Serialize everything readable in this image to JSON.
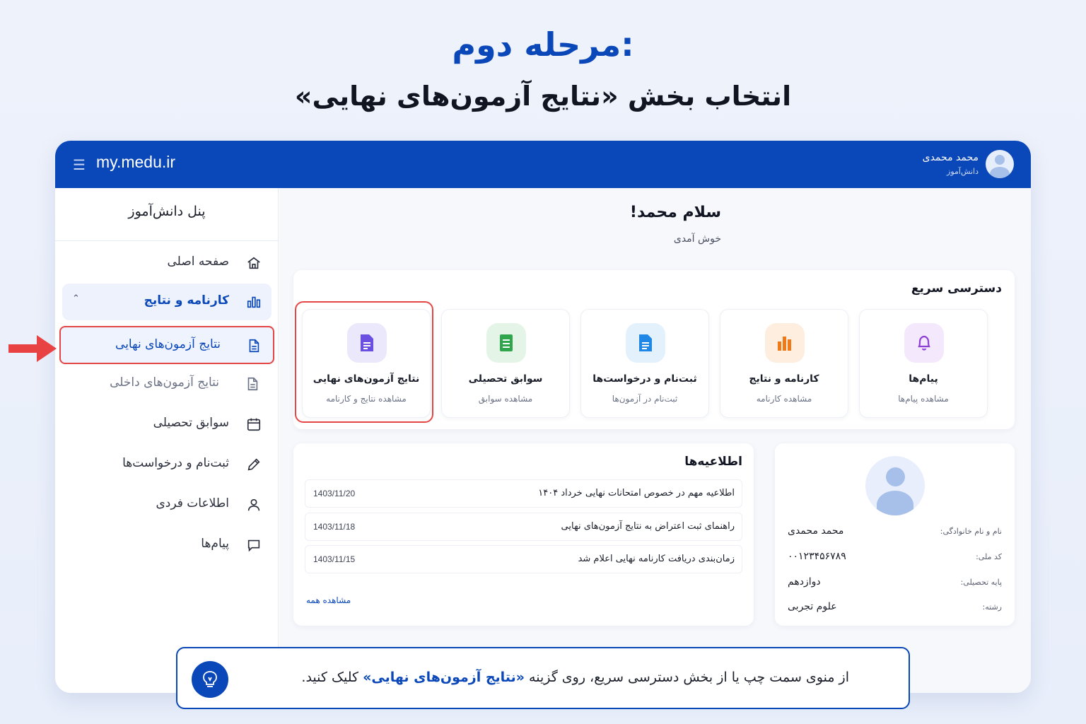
{
  "heading": {
    "step": "مرحله دوم:",
    "subtitle": "انتخاب بخش «نتایج آزمون‌های نهایی»"
  },
  "topbar": {
    "site": "my.medu.ir",
    "user_name": "محمد محمدی",
    "user_role": "دانش‌آموز",
    "menu_icon": "hamburger-icon",
    "bar_color": "#0a47b8"
  },
  "sidebar": {
    "title": "پنل دانش‌آموز",
    "items": [
      {
        "label": "صفحه اصلی",
        "icon": "home-icon"
      },
      {
        "label": "کارنامه و نتایج",
        "icon": "bar-chart-icon",
        "expanded": true
      },
      {
        "label": "نتایج آزمون‌های نهایی",
        "icon": "document-icon",
        "selected": true
      },
      {
        "label": "نتایج آزمون‌های داخلی",
        "icon": "document-icon"
      },
      {
        "label": "سوابق تحصیلی",
        "icon": "calendar-icon"
      },
      {
        "label": "ثبت‌نام و درخواست‌ها",
        "icon": "edit-icon"
      },
      {
        "label": "اطلاعات فردی",
        "icon": "user-icon"
      },
      {
        "label": "پیام‌ها",
        "icon": "chat-icon"
      }
    ]
  },
  "main": {
    "greeting": "سلام محمد!",
    "welcome": "خوش آمدی"
  },
  "quick_access": {
    "title": "دسترسی سریع",
    "tiles": [
      {
        "label": "نتایج آزمون‌های نهایی",
        "sub": "مشاهده نتایج و کارنامه",
        "icon": "report-icon",
        "color": "#6a4fe0",
        "highlighted": true
      },
      {
        "label": "سوابق تحصیلی",
        "sub": "مشاهده سوابق",
        "icon": "sheet-icon",
        "color": "#2fa64c"
      },
      {
        "label": "ثبت‌نام و درخواست‌ها",
        "sub": "ثبت‌نام در آزمون‌ها",
        "icon": "file-icon",
        "color": "#1f87e5"
      },
      {
        "label": "کارنامه و نتایج",
        "sub": "مشاهده کارنامه",
        "icon": "bar-chart-icon",
        "color": "#f07a18"
      },
      {
        "label": "پیام‌ها",
        "sub": "مشاهده پیام‌ها",
        "icon": "bell-icon",
        "color": "#8e3fd6"
      }
    ]
  },
  "announcements": {
    "title": "اطلاعیه‌ها",
    "items": [
      {
        "text": "اطلاعیه مهم در خصوص امتحانات نهایی خرداد ۱۴۰۴",
        "date": "1403/11/20"
      },
      {
        "text": "راهنمای ثبت اعتراض به نتایج آزمون‌های نهایی",
        "date": "1403/11/18"
      },
      {
        "text": "زمان‌بندی دریافت کارنامه نهایی اعلام شد",
        "date": "1403/11/15"
      }
    ],
    "see_all": "مشاهده همه"
  },
  "profile": {
    "rows": [
      {
        "key": "نام و نام خانوادگی:",
        "value": "محمد محمدی"
      },
      {
        "key": "کد ملی:",
        "value": "۰۰۱۲۳۴۵۶۷۸۹"
      },
      {
        "key": "پایه تحصیلی:",
        "value": "دوازدهم"
      },
      {
        "key": "رشته:",
        "value": "علوم تجربی"
      }
    ]
  },
  "tip": {
    "before": "از منوی سمت چپ یا از بخش دسترسی سریع، روی گزینه ",
    "emphasis": "«نتایج آزمون‌های نهایی»",
    "after": " کلیک کنید.",
    "icon": "lightbulb-icon"
  },
  "colors": {
    "accent": "#0a47b8",
    "highlight": "#e44646"
  }
}
